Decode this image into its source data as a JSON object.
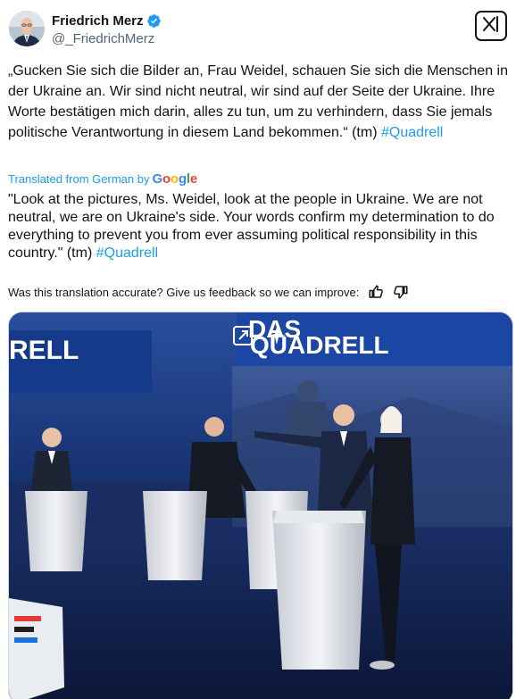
{
  "author": {
    "display_name": "Friedrich Merz",
    "handle": "@_FriedrichMerz",
    "verified_icon": "verified-badge-icon",
    "avatar_icon": "profile-avatar"
  },
  "actions": {
    "grok_icon": "grok-icon"
  },
  "tweet": {
    "text": "„Gucken Sie sich die Bilder an, Frau Weidel, schauen Sie sich die Menschen in der Ukraine an. Wir sind nicht neutral, wir sind auf der Seite der Ukraine. Ihre Worte bestätigen mich darin, alles zu tun, um zu verhindern, dass Sie jemals politische Verantwortung in diesem Land bekommen.“ (tm)",
    "hashtag": "#Quadrell"
  },
  "translation": {
    "label": "Translated from German by",
    "provider": "Google",
    "text": "\"Look at the pictures, Ms. Weidel, look at the people in Ukraine. We are not neutral, we are on Ukraine's side. Your words confirm my determination to do everything to prevent you from ever assuming political responsibility in this country.\" (tm)",
    "hashtag": "#Quadrell",
    "feedback_prompt": "Was this translation accurate? Give us feedback so we can improve:"
  },
  "media": {
    "banner_left": "RELL",
    "banner_title_line1": "DAS",
    "banner_title_line2": "QUADRELL",
    "expand_icon": "open-external-icon",
    "sparkle_icon": "sparkle-icon"
  },
  "colors": {
    "accent": "#1d9bf0",
    "text": "#0f1419",
    "secondary": "#536471",
    "studio_blue": "#0c1c3f"
  }
}
